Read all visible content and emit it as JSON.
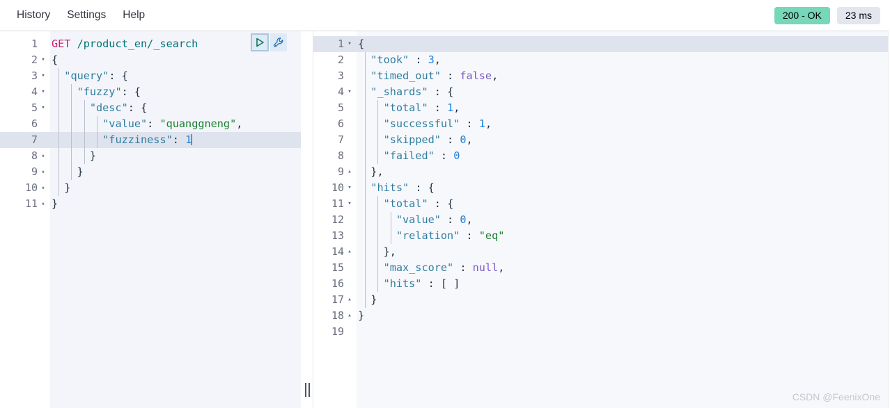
{
  "menu": {
    "items": [
      {
        "label": "History",
        "name": "menu-history"
      },
      {
        "label": "Settings",
        "name": "menu-settings"
      },
      {
        "label": "Help",
        "name": "menu-help"
      }
    ]
  },
  "status": {
    "response_code": "200 - OK",
    "response_time": "23 ms",
    "status_color": "#76d7b9",
    "time_color": "#e3e6ef"
  },
  "actions": {
    "run_icon": "play-triangle-icon",
    "wrench_icon": "wrench-icon",
    "run_title": "Click to send request",
    "wrench_title": "Open documentation / options"
  },
  "request_editor": {
    "active_line": 7,
    "total_lines": 11,
    "lines": [
      {
        "n": "1",
        "fold": "",
        "text": "GET /product_en/_search"
      },
      {
        "n": "2",
        "fold": "▾",
        "text": "{"
      },
      {
        "n": "3",
        "fold": "▾",
        "text": "  \"query\": {"
      },
      {
        "n": "4",
        "fold": "▾",
        "text": "    \"fuzzy\": {"
      },
      {
        "n": "5",
        "fold": "▾",
        "text": "      \"desc\": {"
      },
      {
        "n": "6",
        "fold": "",
        "text": "        \"value\": \"quanggneng\","
      },
      {
        "n": "7",
        "fold": "",
        "text": "        \"fuzziness\": 1"
      },
      {
        "n": "8",
        "fold": "▴",
        "text": "      }"
      },
      {
        "n": "9",
        "fold": "▴",
        "text": "    }"
      },
      {
        "n": "10",
        "fold": "▴",
        "text": "  }"
      },
      {
        "n": "11",
        "fold": "▴",
        "text": "}"
      }
    ]
  },
  "response_editor": {
    "active_line": 1,
    "total_lines": 19,
    "lines": [
      {
        "n": "1",
        "fold": "▾",
        "text": "{"
      },
      {
        "n": "2",
        "fold": "",
        "text": "  \"took\" : 3,"
      },
      {
        "n": "3",
        "fold": "",
        "text": "  \"timed_out\" : false,"
      },
      {
        "n": "4",
        "fold": "▾",
        "text": "  \"_shards\" : {"
      },
      {
        "n": "5",
        "fold": "",
        "text": "    \"total\" : 1,"
      },
      {
        "n": "6",
        "fold": "",
        "text": "    \"successful\" : 1,"
      },
      {
        "n": "7",
        "fold": "",
        "text": "    \"skipped\" : 0,"
      },
      {
        "n": "8",
        "fold": "",
        "text": "    \"failed\" : 0"
      },
      {
        "n": "9",
        "fold": "▴",
        "text": "  },"
      },
      {
        "n": "10",
        "fold": "▾",
        "text": "  \"hits\" : {"
      },
      {
        "n": "11",
        "fold": "▾",
        "text": "    \"total\" : {"
      },
      {
        "n": "12",
        "fold": "",
        "text": "      \"value\" : 0,"
      },
      {
        "n": "13",
        "fold": "",
        "text": "      \"relation\" : \"eq\""
      },
      {
        "n": "14",
        "fold": "▴",
        "text": "    },"
      },
      {
        "n": "15",
        "fold": "",
        "text": "    \"max_score\" : null,"
      },
      {
        "n": "16",
        "fold": "",
        "text": "    \"hits\" : [ ]"
      },
      {
        "n": "17",
        "fold": "▴",
        "text": "  }"
      },
      {
        "n": "18",
        "fold": "▴",
        "text": "}"
      },
      {
        "n": "19",
        "fold": "",
        "text": ""
      }
    ]
  },
  "watermark": {
    "text": "CSDN @FeenixOne"
  },
  "divider": {
    "handle_name": "split-drag-handle"
  }
}
